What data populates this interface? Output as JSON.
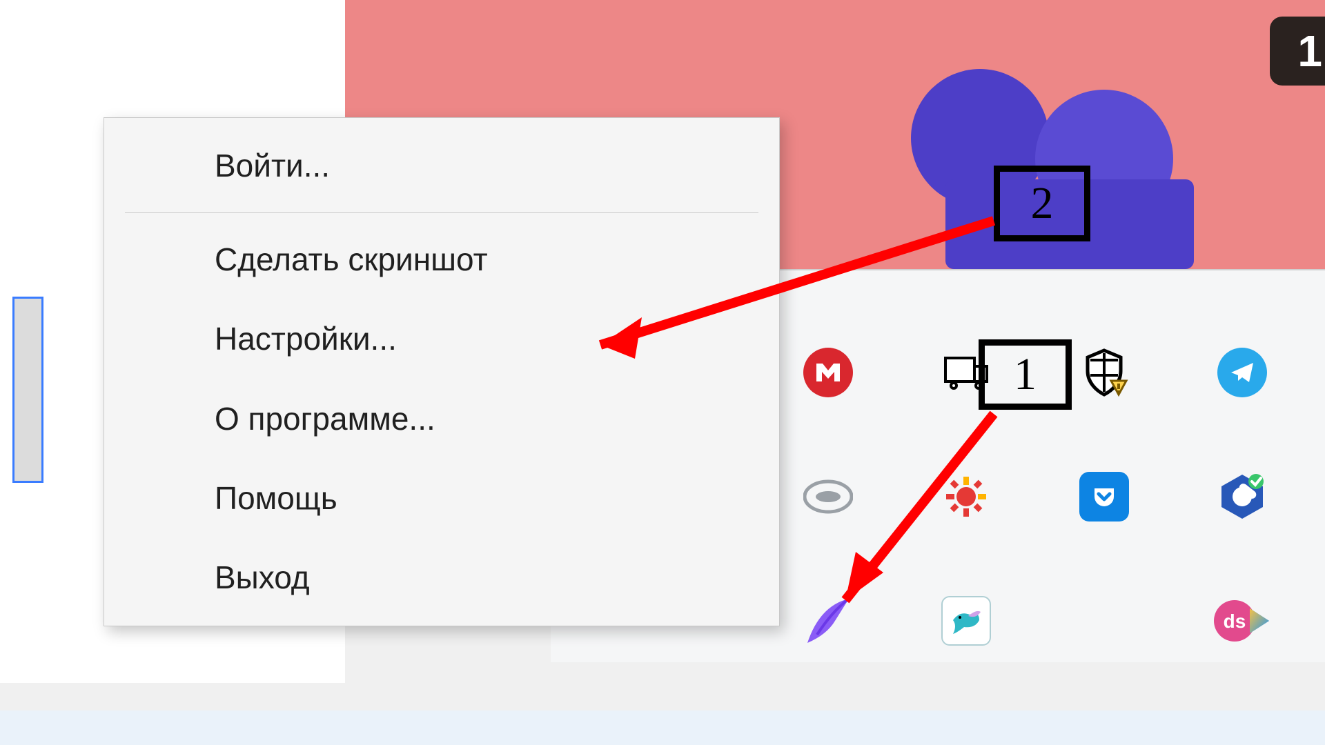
{
  "contextMenu": {
    "login": "Войти...",
    "screenshot": "Сделать скриншот",
    "settings": "Настройки...",
    "about": "О программе...",
    "help": "Помощь",
    "exit": "Выход"
  },
  "annotations": {
    "marker1": "1",
    "marker2": "2"
  },
  "topTag": "1",
  "trayIcons": {
    "mega": "mega-icon",
    "truck": "truck-icon",
    "defender": "defender-shield-icon",
    "telegram": "telegram-icon",
    "eset": "eset-icon",
    "gear": "gear-icon",
    "pocket": "pocket-icon",
    "hexring": "hex-ring-icon",
    "feather": "feather-icon",
    "colibri": "colibri-icon",
    "tiles": "color-tiles-icon",
    "ds": "ds-play-icon"
  }
}
